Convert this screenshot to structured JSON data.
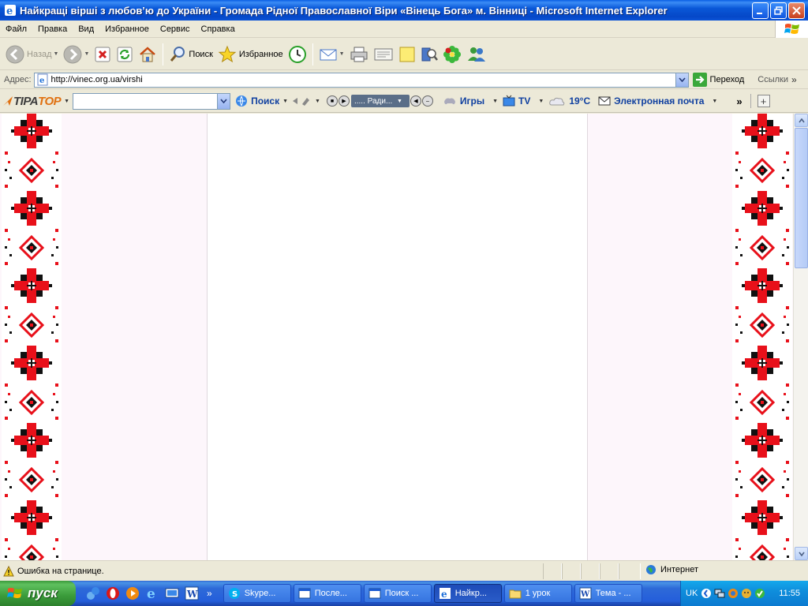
{
  "window": {
    "title": "Найкращі вірші з любов’ю до України - Громада Рідної Православної Віри «Вінець Бога» м. Вінниці - Microsoft Internet Explorer"
  },
  "menu": [
    "Файл",
    "Правка",
    "Вид",
    "Избранное",
    "Сервис",
    "Справка"
  ],
  "toolbar": {
    "back_label": "Назад",
    "search_label": "Поиск",
    "favorites_label": "Избранное"
  },
  "address": {
    "label": "Адрес:",
    "url": "http://vinec.org.ua/virshi",
    "go_label": "Переход",
    "links_label": "Ссылки"
  },
  "tiptop": {
    "logo_a": "TIPA",
    "logo_b": "TOP",
    "search_label": "Поиск",
    "radio_label": "..... Ради...",
    "games_label": "Игры",
    "tv_label": "TV",
    "weather_label": "19°C",
    "mail_label": "Электронная почта",
    "more_label": "»"
  },
  "status": {
    "error_text": "Ошибка на странице.",
    "zone_text": "Интернет"
  },
  "taskbar": {
    "start_label": "пуск",
    "tasks": [
      {
        "label": "Skype..."
      },
      {
        "label": "После..."
      },
      {
        "label": "Поиск ..."
      },
      {
        "label": "Найкр..."
      },
      {
        "label": "1 урок"
      },
      {
        "label": "Тема - ..."
      }
    ],
    "lang": "UK",
    "clock": "11:55"
  },
  "colors": {
    "ornament_red": "#e8101a",
    "ornament_black": "#111111",
    "page_bg": "#fdf6fb"
  }
}
